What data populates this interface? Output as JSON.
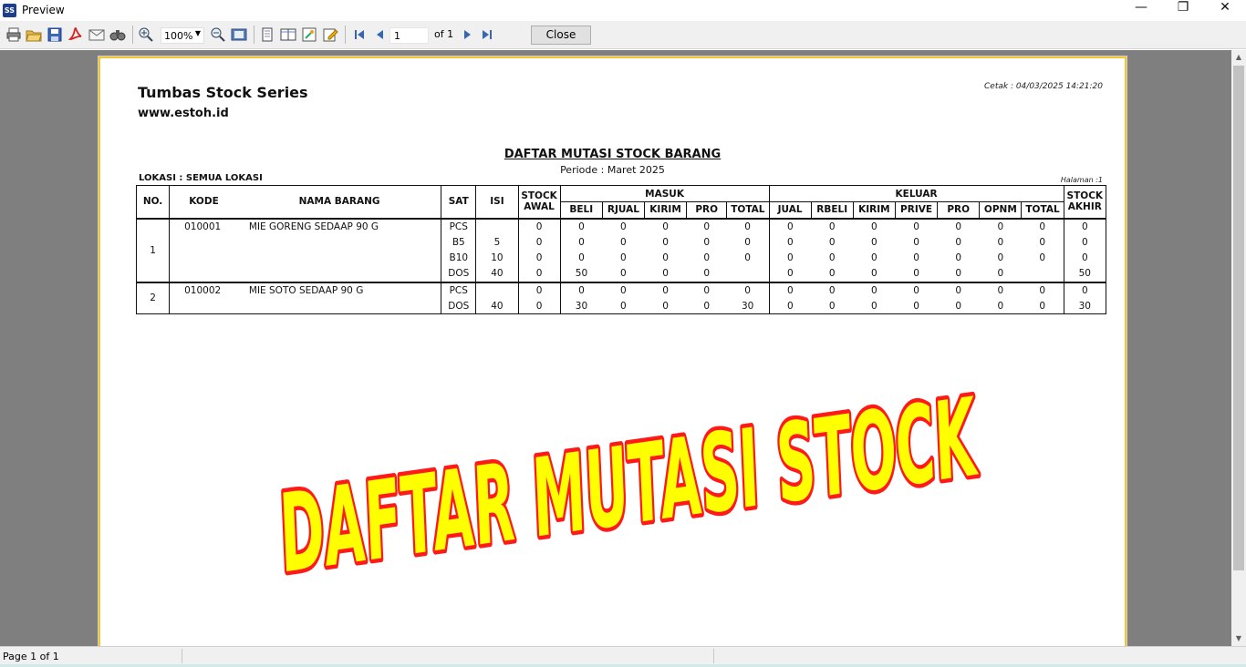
{
  "window": {
    "title": "Preview",
    "icon_label": "SS",
    "minimize": "—",
    "restore": "❐",
    "close": "✕"
  },
  "toolbar": {
    "zoom": "100%",
    "page_input": "1",
    "page_of": "of 1",
    "close_label": "Close",
    "icons": [
      "print-icon",
      "open-icon",
      "save-icon",
      "pdf-icon",
      "email-icon",
      "find-icon",
      "zoom-in-icon",
      "zoom-out-icon",
      "fit-page-icon",
      "single-page-icon",
      "two-page-icon",
      "settings-icon",
      "edit-icon",
      "first-page-icon",
      "prev-page-icon",
      "next-page-icon",
      "last-page-icon"
    ]
  },
  "report": {
    "company": "Tumbas Stock Series",
    "website": "www.estoh.id",
    "cetak": "Cetak :  04/03/2025 14:21:20",
    "heading": "DAFTAR MUTASI STOCK BARANG",
    "periode": "Periode : Maret 2025",
    "lokasi": "LOKASI : SEMUA LOKASI",
    "halaman": "Halaman :1",
    "headers": {
      "no": "NO.",
      "kode": "KODE",
      "nama": "NAMA BARANG",
      "sat": "SAT",
      "isi": "ISI",
      "stock_awal_1": "STOCK",
      "stock_awal_2": "AWAL",
      "masuk": "MASUK",
      "keluar": "KELUAR",
      "stock_akhir_1": "STOCK",
      "stock_akhir_2": "AKHIR",
      "masuk_cols": [
        "BELI",
        "RJUAL",
        "KIRIM",
        "PRO",
        "TOTAL"
      ],
      "keluar_cols": [
        "JUAL",
        "RBELI",
        "KIRIM",
        "PRIVE",
        "PRO",
        "OPNM",
        "TOTAL"
      ]
    },
    "items": [
      {
        "no": "1",
        "kode": "010001",
        "nama": "MIE GORENG SEDAAP 90 G",
        "rows": [
          {
            "sat": "PCS",
            "isi": "",
            "awal": "0",
            "masuk": [
              "0",
              "0",
              "0",
              "0",
              "0"
            ],
            "keluar": [
              "0",
              "0",
              "0",
              "0",
              "0",
              "0",
              "0"
            ],
            "akhir": "0"
          },
          {
            "sat": "B5",
            "isi": "5",
            "awal": "0",
            "masuk": [
              "0",
              "0",
              "0",
              "0",
              "0"
            ],
            "keluar": [
              "0",
              "0",
              "0",
              "0",
              "0",
              "0",
              "0"
            ],
            "akhir": "0"
          },
          {
            "sat": "B10",
            "isi": "10",
            "awal": "0",
            "masuk": [
              "0",
              "0",
              "0",
              "0",
              "0"
            ],
            "keluar": [
              "0",
              "0",
              "0",
              "0",
              "0",
              "0",
              "0"
            ],
            "akhir": "0"
          },
          {
            "sat": "DOS",
            "isi": "40",
            "awal": "0",
            "masuk": [
              "50",
              "0",
              "0",
              "0",
              ""
            ],
            "keluar": [
              "0",
              "0",
              "0",
              "0",
              "0",
              "0",
              ""
            ],
            "akhir": "50"
          }
        ]
      },
      {
        "no": "2",
        "kode": "010002",
        "nama": "MIE SOTO SEDAAP 90 G",
        "rows": [
          {
            "sat": "PCS",
            "isi": "",
            "awal": "0",
            "masuk": [
              "0",
              "0",
              "0",
              "0",
              "0"
            ],
            "keluar": [
              "0",
              "0",
              "0",
              "0",
              "0",
              "0",
              "0"
            ],
            "akhir": "0"
          },
          {
            "sat": "DOS",
            "isi": "40",
            "awal": "0",
            "masuk": [
              "30",
              "0",
              "0",
              "0",
              "30"
            ],
            "keluar": [
              "0",
              "0",
              "0",
              "0",
              "0",
              "0",
              "0"
            ],
            "akhir": "30"
          }
        ]
      }
    ]
  },
  "overlay": {
    "text": "DAFTAR MUTASI STOCK",
    "fill": "#ffff00",
    "stroke": "#ff1a1a"
  },
  "status": {
    "page": "Page 1 of 1"
  }
}
